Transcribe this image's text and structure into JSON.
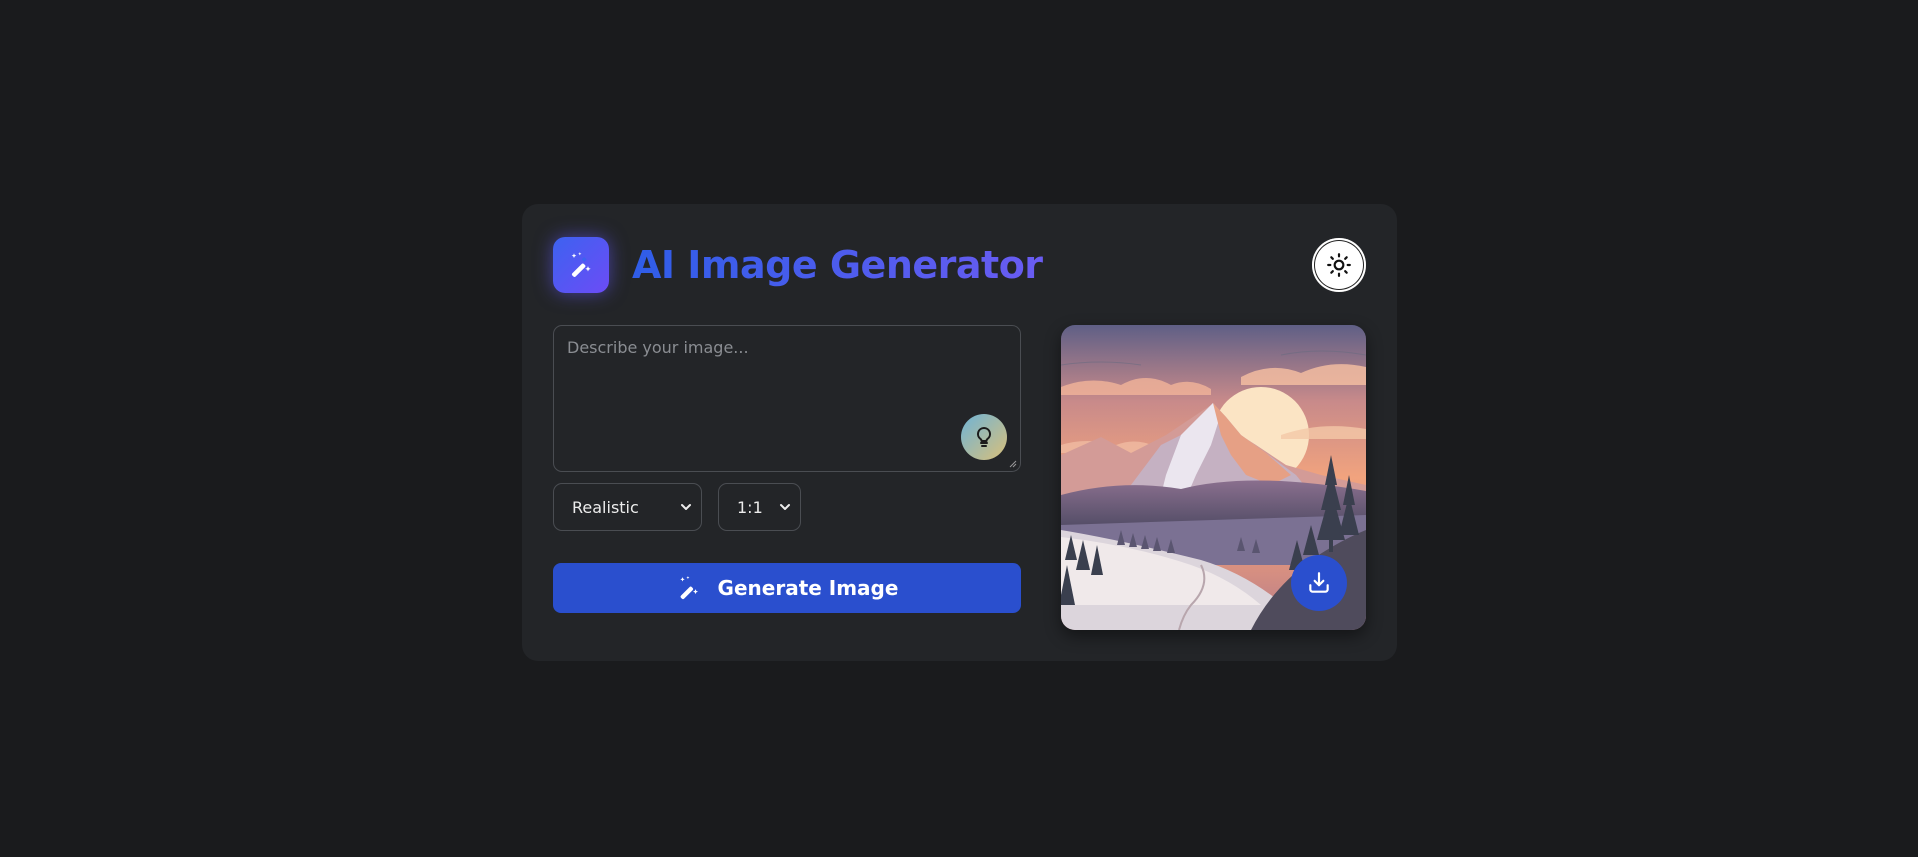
{
  "header": {
    "title": "AI Image Generator",
    "logo_icon": "magic-wand-icon",
    "theme_toggle_icon": "sun-icon"
  },
  "prompt": {
    "value": "",
    "placeholder": "Describe your image...",
    "idea_button_icon": "lightbulb-icon"
  },
  "controls": {
    "style_selected": "Realistic",
    "ratio_selected": "1:1"
  },
  "generate_button": {
    "label": "Generate Image",
    "icon": "magic-wand-icon"
  },
  "preview": {
    "download_icon": "download-icon"
  },
  "colors": {
    "background": "#1a1b1d",
    "card": "#232528",
    "accent": "#2a4fce",
    "title_gradient_start": "#2f5de8",
    "title_gradient_end": "#6a5cf2"
  }
}
